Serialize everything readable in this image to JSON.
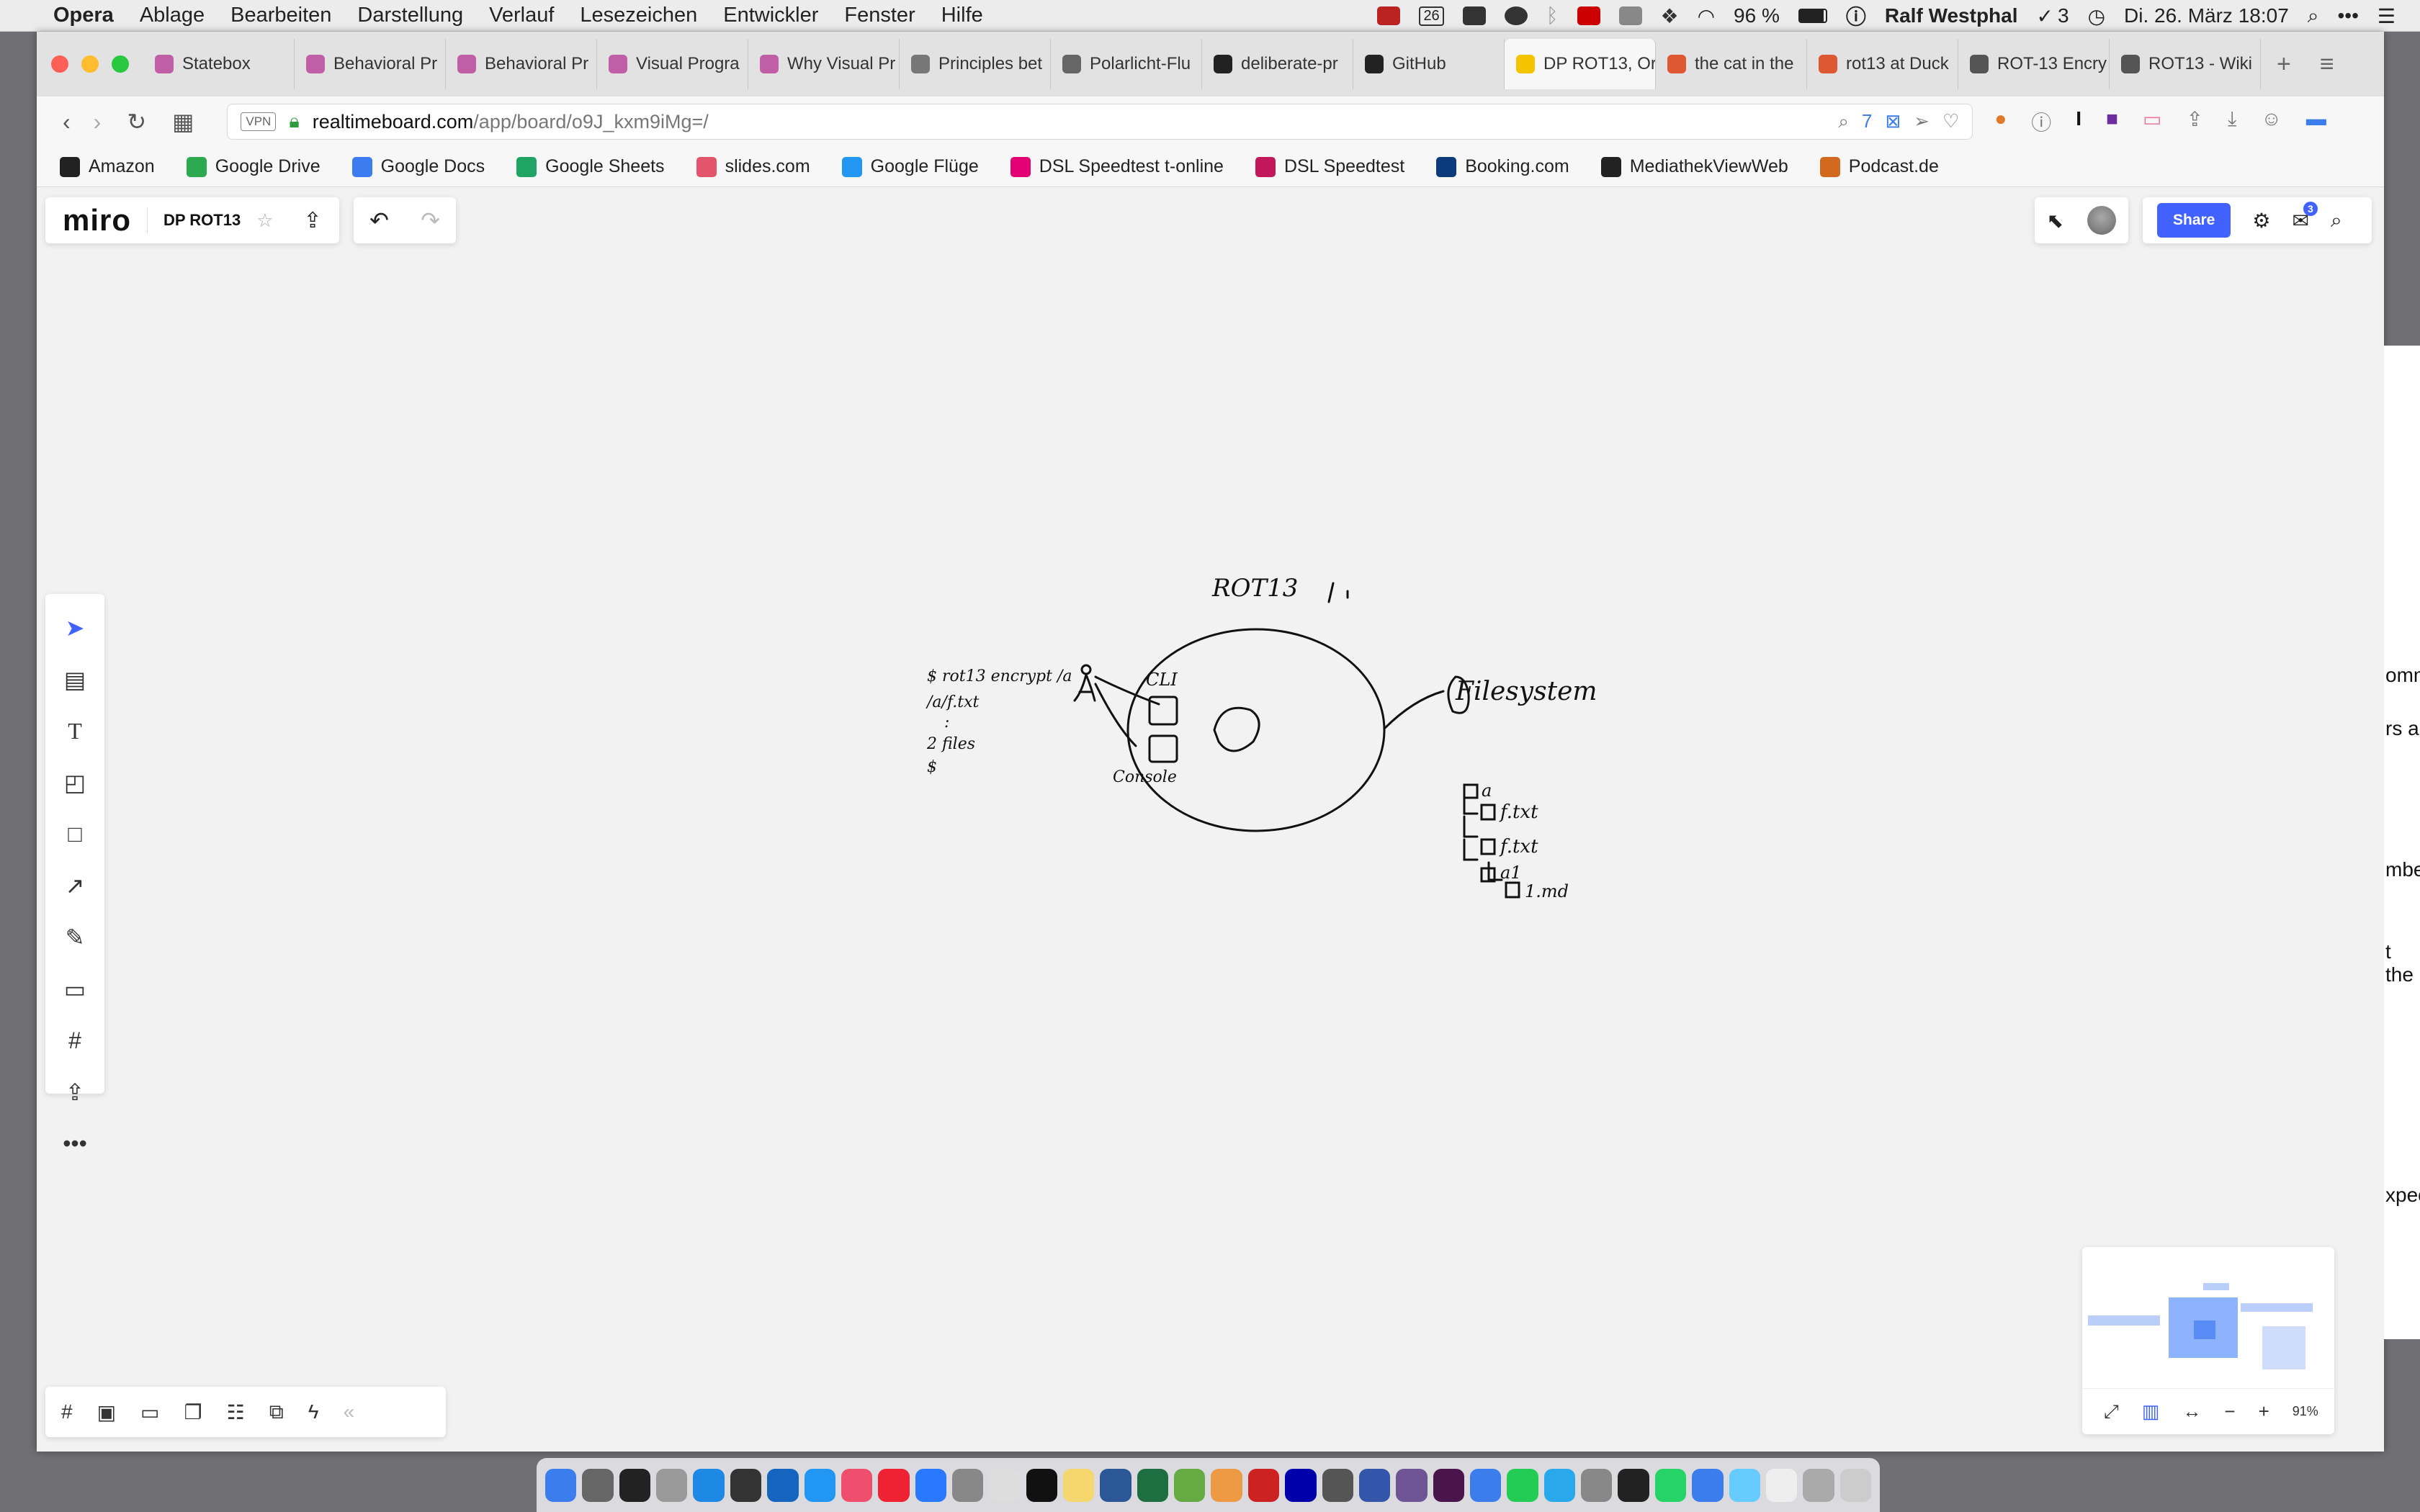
{
  "menubar": {
    "app": "Opera",
    "items": [
      "Ablage",
      "Bearbeiten",
      "Darstellung",
      "Verlauf",
      "Lesezeichen",
      "Entwickler",
      "Fenster",
      "Hilfe"
    ],
    "calendar_day": "26",
    "battery": "96 %",
    "user": "Ralf Westphal",
    "tasks": "3",
    "datetime": "Di. 26. März 18:07"
  },
  "tabs": [
    {
      "label": "Statebox",
      "color": "#c05ea6"
    },
    {
      "label": "Behavioral Pr",
      "color": "#c05ea6"
    },
    {
      "label": "Behavioral Pr",
      "color": "#c05ea6"
    },
    {
      "label": "Visual Progra",
      "color": "#c05ea6"
    },
    {
      "label": "Why Visual Pr",
      "color": "#c05ea6"
    },
    {
      "label": "Principles bet",
      "color": "#777777"
    },
    {
      "label": "Polarlicht-Flu",
      "color": "#666666"
    },
    {
      "label": "deliberate-pr",
      "color": "#222222"
    },
    {
      "label": "GitHub",
      "color": "#222222"
    },
    {
      "label": "DP ROT13, Or",
      "color": "#f5c400",
      "active": true
    },
    {
      "label": "the cat in the",
      "color": "#de5833"
    },
    {
      "label": "rot13 at Duck",
      "color": "#de5833"
    },
    {
      "label": "ROT-13 Encry",
      "color": "#555555"
    },
    {
      "label": "ROT13 - Wiki",
      "color": "#555555"
    }
  ],
  "address": {
    "vpn": "VPN",
    "host": "realtimeboard.com",
    "path": "/app/board/o9J_kxm9iMg=/",
    "blocked_count": "7"
  },
  "bookmarks": [
    {
      "label": "Amazon",
      "color": "#222222"
    },
    {
      "label": "Google Drive",
      "color": "#2da94f"
    },
    {
      "label": "Google Docs",
      "color": "#3d7cf0"
    },
    {
      "label": "Google Sheets",
      "color": "#1fa463"
    },
    {
      "label": "slides.com",
      "color": "#e4556b"
    },
    {
      "label": "Google Flüge",
      "color": "#2196f3"
    },
    {
      "label": "DSL Speedtest t-online",
      "color": "#e20074"
    },
    {
      "label": "DSL Speedtest",
      "color": "#c2185b"
    },
    {
      "label": "Booking.com",
      "color": "#0c3b7c"
    },
    {
      "label": "MediathekViewWeb",
      "color": "#222222"
    },
    {
      "label": "Podcast.de",
      "color": "#d2691e"
    }
  ],
  "miro": {
    "logo": "miro",
    "board_name": "DP ROT13",
    "share_label": "Share",
    "zoom": "91%",
    "notification_count": "3"
  },
  "toolbar": [
    "select",
    "templates",
    "text",
    "sticky-note",
    "shape",
    "arrow",
    "pen",
    "comment",
    "frame",
    "upload",
    "more"
  ],
  "sketch": {
    "title": "ROT13",
    "cli": "CLI",
    "console": "Console",
    "filesystem": "Filesystem",
    "cmd1": "$ rot13 encrypt /a",
    "cmd2": "/a/f.txt",
    "cmd3": ":",
    "cmd4": "2 files",
    "cmd5": "$",
    "tree_root": "a",
    "tree1": "f.txt",
    "tree2": "f.txt",
    "tree3": "a1",
    "tree4": "1.md"
  },
  "right_edge": [
    "omm",
    "rs a",
    "mbe",
    "t the",
    "xpec"
  ],
  "colors": {
    "miro_blue": "#4262ff",
    "active_tab": "#f5c400"
  }
}
